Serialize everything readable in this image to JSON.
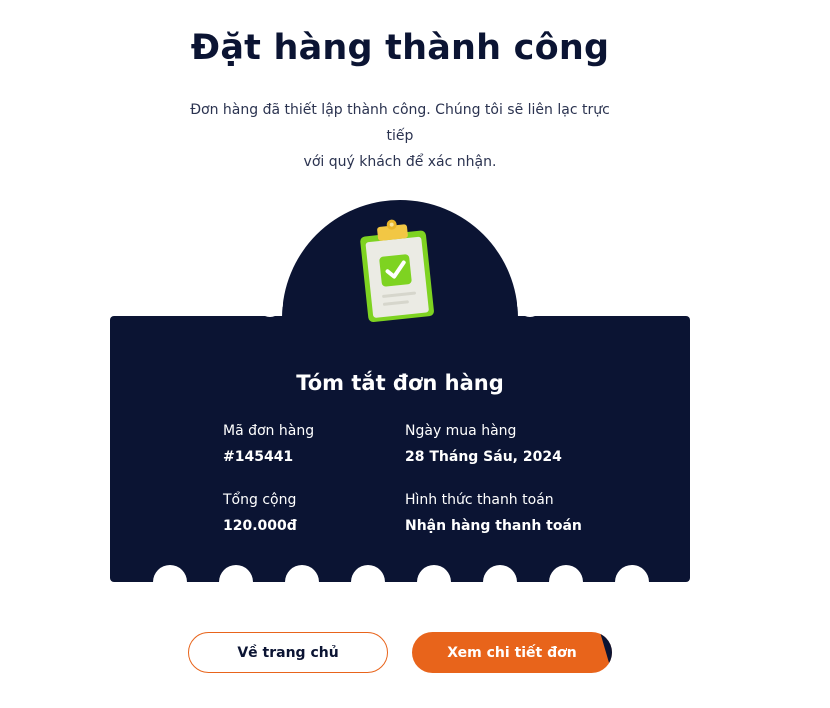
{
  "page": {
    "title": "Đặt hàng thành công",
    "subtitle_line1": "Đơn hàng đã thiết lập thành công. Chúng tôi sẽ liên lạc trực tiếp",
    "subtitle_line2": "với quý khách để xác nhận."
  },
  "summary": {
    "title": "Tóm tắt đơn hàng",
    "order_id_label": "Mã đơn hàng",
    "order_id_value": "#145441",
    "date_label": "Ngày mua hàng",
    "date_value": "28 Tháng Sáu, 2024",
    "total_label": "Tổng cộng",
    "total_value": "120.000đ",
    "payment_label": "Hình thức thanh toán",
    "payment_value": "Nhận hàng thanh toán",
    "icon": "clipboard-check-icon"
  },
  "actions": {
    "home_label": "Về trang chủ",
    "details_label": "Xem chi tiết đơn"
  },
  "colors": {
    "navy": "#0b1433",
    "accent": "#e8641b",
    "icon_green": "#7ed321"
  }
}
